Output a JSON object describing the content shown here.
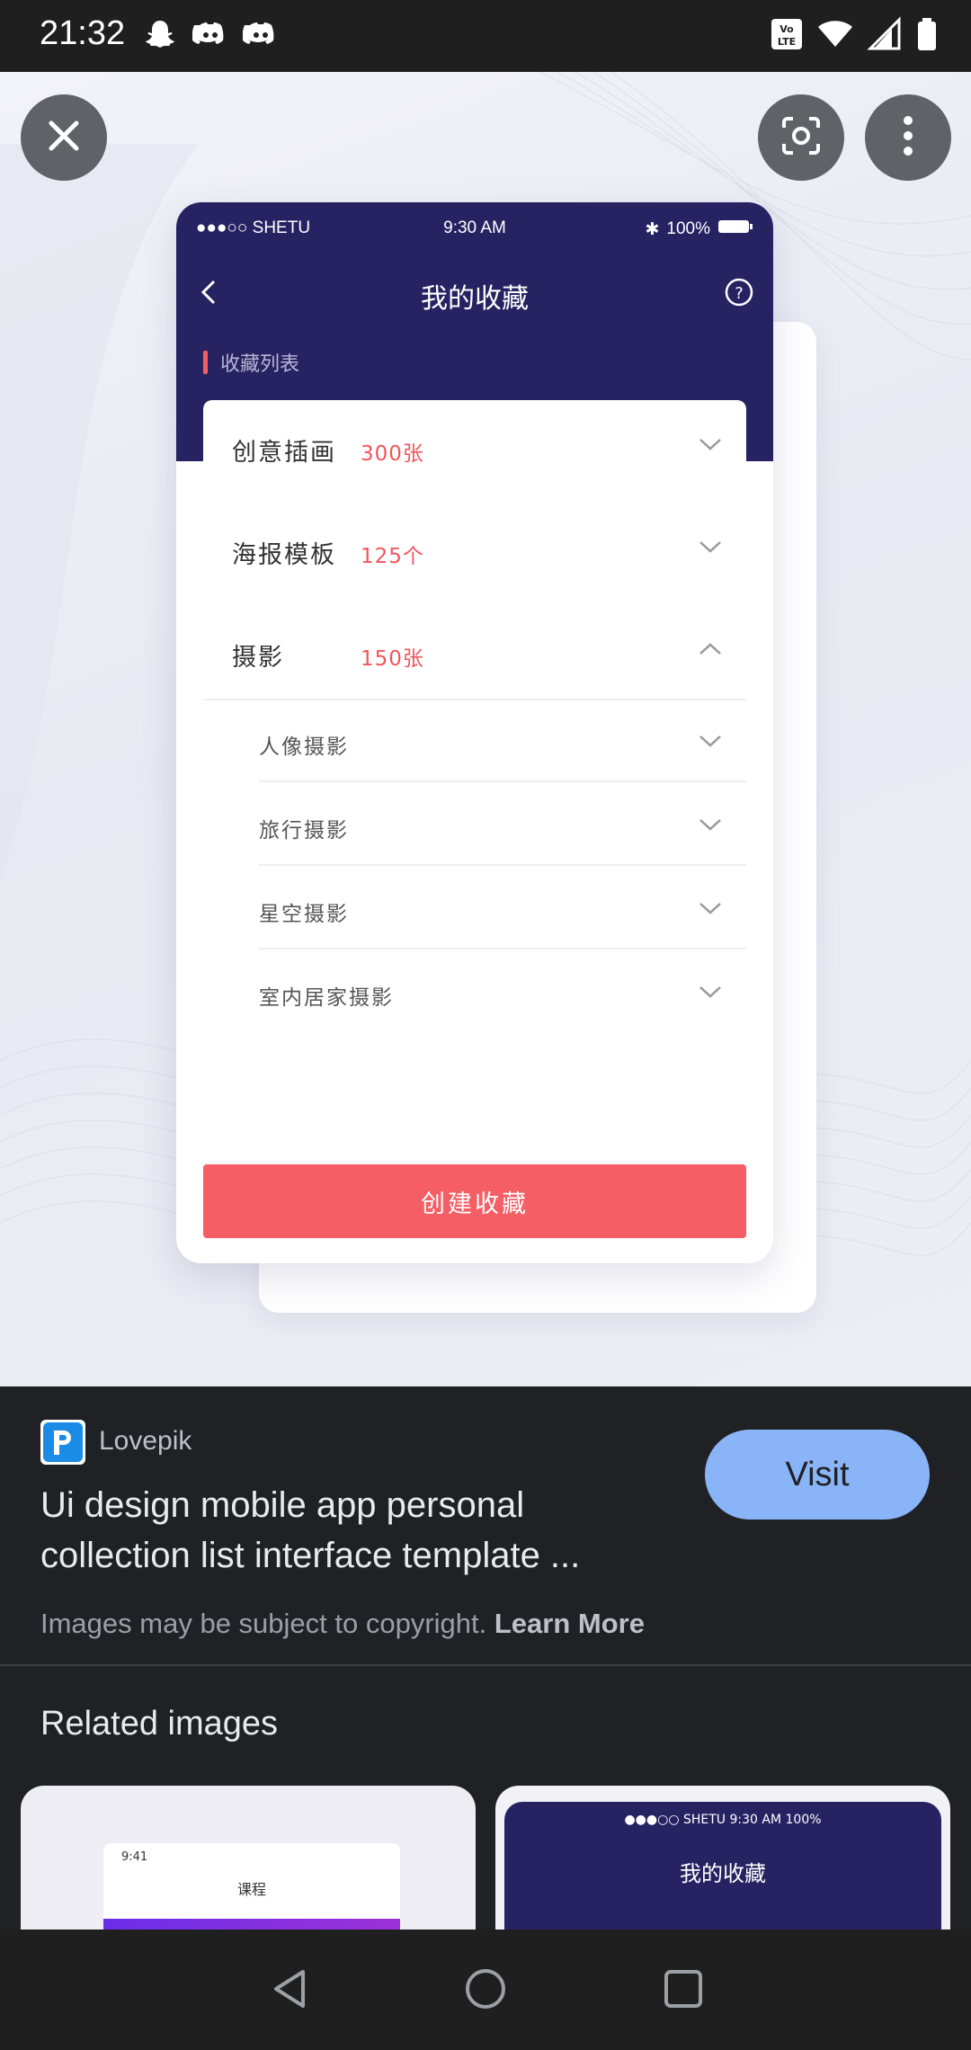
{
  "status_bar": {
    "time": "21:32"
  },
  "mockup": {
    "carrier": "●●●○○ SHETU",
    "time": "9:30 AM",
    "battery": "100%",
    "title": "我的收藏",
    "section": "收藏列表",
    "rows": [
      {
        "label": "创意插画",
        "count": "300张",
        "expanded": false
      },
      {
        "label": "海报模板",
        "count": "125个",
        "expanded": false
      },
      {
        "label": "摄影",
        "count": "150张",
        "expanded": true
      }
    ],
    "sub_items": [
      "人像摄影",
      "旅行摄影",
      "星空摄影",
      "室内居家摄影"
    ],
    "create_button": "创建收藏",
    "accent": "#f45e64",
    "header_color": "#272363"
  },
  "result": {
    "source": "Lovepik",
    "visit_label": "Visit",
    "title": "Ui design mobile app personal collection list interface template ...",
    "copyright": "Images may be subject to copyright.",
    "learn_more": "Learn More"
  },
  "related": {
    "title": "Related images",
    "cards": [
      {
        "time": "9:41",
        "title": "课程"
      },
      {
        "status": "●●●○○ SHETU   9:30 AM   100%",
        "title": "我的收藏"
      }
    ]
  },
  "icons": [
    "snapchat-icon",
    "discord-icon",
    "volte-icon",
    "wifi-icon",
    "signal-icon",
    "battery-icon",
    "close-icon",
    "lens-icon",
    "more-vert-icon",
    "back-icon",
    "home-icon",
    "recents-icon"
  ]
}
